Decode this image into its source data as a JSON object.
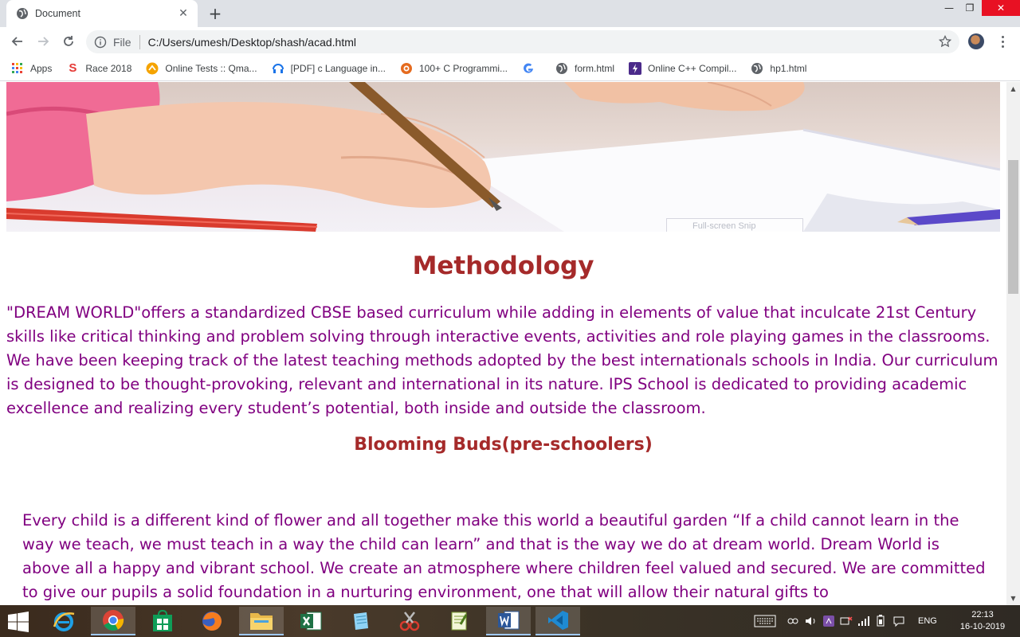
{
  "browser": {
    "tab_title": "Document",
    "address_scheme": "File",
    "address_url": "C:/Users/umesh/Desktop/shash/acad.html",
    "bookmarks": [
      {
        "label": "Apps",
        "icon": "apps-grid-icon"
      },
      {
        "label": "Race 2018",
        "icon": "race-s-icon"
      },
      {
        "label": "Online Tests :: Qma...",
        "icon": "qma-icon"
      },
      {
        "label": "[PDF] c Language in...",
        "icon": "pdf-icon"
      },
      {
        "label": "100+ C Programmi...",
        "icon": "c-prog-icon"
      },
      {
        "label": "",
        "icon": "google-icon"
      },
      {
        "label": "form.html",
        "icon": "globe-icon"
      },
      {
        "label": "Online C++ Compil...",
        "icon": "compiler-icon"
      },
      {
        "label": "hp1.html",
        "icon": "globe-icon"
      }
    ]
  },
  "page": {
    "snip_label": "Full-screen Snip",
    "methodology_heading": "Methodology",
    "methodology_text": "\"DREAM WORLD\"offers a standardized CBSE based curriculum while adding in elements of value that inculcate 21st Century skills like critical thinking and problem solving through interactive events, activities and role playing games in the classrooms. We have been keeping track of the latest teaching methods adopted by the best internationals schools in India. Our curriculum is designed to be thought-provoking, relevant and international in its nature. IPS School is dedicated to providing academic excellence and realizing every student’s potential, both inside and outside the classroom.",
    "buds_heading": "Blooming Buds(pre-schoolers)",
    "buds_text": "Every child is a different kind of flower and all together make this world a beautiful garden “If a child cannot learn in the way we teach, we must teach in a way the child can learn” and that is the way we do at dream world. Dream World is above all a happy and vibrant school. We create an atmosphere where children feel valued and secured. We are committed to give our pupils a solid foundation in a nurturing environment, one that will allow their natural gifts to"
  },
  "taskbar": {
    "apps": [
      "internet-explorer",
      "chrome",
      "store",
      "firefox",
      "file-explorer",
      "excel",
      "notepad",
      "snipping-tool",
      "notepad-plus-plus",
      "word",
      "vscode"
    ],
    "language": "ENG",
    "time": "22:13",
    "date": "16-10-2019"
  },
  "colors": {
    "heading": "#a52a2a",
    "body_text": "#800080"
  }
}
